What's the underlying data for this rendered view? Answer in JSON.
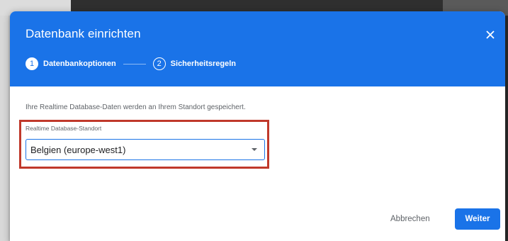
{
  "dialog": {
    "title": "Datenbank einrichten",
    "close_icon": "close-icon",
    "steps": [
      {
        "number": "1",
        "label": "Datenbankoptionen",
        "active": true
      },
      {
        "number": "2",
        "label": "Sicherheitsregeln",
        "active": false
      }
    ],
    "info_text": "Ihre Realtime Database-Daten werden an Ihrem Standort gespeichert.",
    "location_field": {
      "label": "Realtime Database-Standort",
      "selected": "Belgien (europe-west1)"
    },
    "actions": {
      "cancel_label": "Abbrechen",
      "continue_label": "Weiter"
    }
  },
  "colors": {
    "header": "#1a73e8",
    "primary_button": "#1a73e8",
    "highlight_border": "#c0392b"
  }
}
